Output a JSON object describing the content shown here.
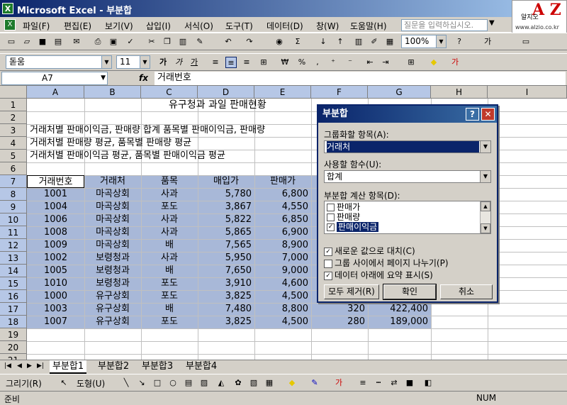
{
  "window": {
    "title": "Microsoft Excel - 부분합"
  },
  "logo": {
    "mark": "A Z",
    "sub": "알지오",
    "url": "www.alzio.co.kr"
  },
  "menu": [
    "파일(F)",
    "편집(E)",
    "보기(V)",
    "삽입(I)",
    "서식(O)",
    "도구(T)",
    "데이터(D)",
    "창(W)",
    "도움말(H)"
  ],
  "help_placeholder": "질문을 입력하십시오.",
  "toolbar": {
    "zoom": "100%",
    "font": "돋움",
    "size": "11"
  },
  "formula_bar": {
    "cell_ref": "A7",
    "fx": "fx",
    "content": "거래번호"
  },
  "columns": [
    "A",
    "B",
    "C",
    "D",
    "E",
    "F",
    "G",
    "H",
    "I"
  ],
  "rows": [
    "1",
    "2",
    "3",
    "4",
    "5",
    "6",
    "7",
    "8",
    "9",
    "10",
    "11",
    "12",
    "13",
    "14",
    "15",
    "16",
    "17",
    "18",
    "19",
    "20",
    "21"
  ],
  "sheet": {
    "title": "유구청과 과일 판매현황",
    "line3": "거래처별 판매이익금, 판매량 합계 품목별 판매이익금, 판매량",
    "line4": "거래처별 판매량 평균, 품목별 판매량 평균",
    "line5": "거래처별 판매이익금 평균, 품목별 판매이익금 평균",
    "headers": [
      "거래번호",
      "거래처",
      "품목",
      "매입가",
      "판매가"
    ],
    "data": [
      [
        "1001",
        "마곡상회",
        "사과",
        "5,780",
        "6,800",
        "",
        ""
      ],
      [
        "1004",
        "마곡상회",
        "포도",
        "3,867",
        "4,550",
        "",
        ""
      ],
      [
        "1006",
        "마곡상회",
        "사과",
        "5,822",
        "6,850",
        "",
        ""
      ],
      [
        "1008",
        "마곡상회",
        "사과",
        "5,865",
        "6,900",
        "",
        ""
      ],
      [
        "1009",
        "마곡상회",
        "배",
        "7,565",
        "8,900",
        "",
        ""
      ],
      [
        "1002",
        "보령청과",
        "사과",
        "5,950",
        "7,000",
        "",
        ""
      ],
      [
        "1005",
        "보령청과",
        "배",
        "7,650",
        "9,000",
        "",
        ""
      ],
      [
        "1010",
        "보령청과",
        "포도",
        "3,910",
        "4,600",
        "",
        ""
      ],
      [
        "1000",
        "유구상회",
        "포도",
        "3,825",
        "4,500",
        "",
        ""
      ],
      [
        "1003",
        "유구상회",
        "배",
        "7,480",
        "8,800",
        "320",
        "422,400"
      ],
      [
        "1007",
        "유구상회",
        "포도",
        "3,825",
        "4,500",
        "280",
        "189,000"
      ]
    ]
  },
  "tabs": [
    "부분합1",
    "부분합2",
    "부분합3",
    "부분합4"
  ],
  "drawbar": {
    "draw": "그리기(R)",
    "shapes": "도형(U)"
  },
  "status": {
    "left": "준비",
    "right": "NUM"
  },
  "dialog": {
    "title": "부분합",
    "group_label": "그룹화할 항목(A):",
    "group_value": "거래처",
    "func_label": "사용할 함수(U):",
    "func_value": "합계",
    "calc_label": "부분합 계산 항목(D):",
    "items": [
      {
        "label": "판매가",
        "checked": false
      },
      {
        "label": "판매량",
        "checked": false
      },
      {
        "label": "판매이익금",
        "checked": true
      }
    ],
    "opt1": "새로운 값으로 대치(C)",
    "opt2": "그룹 사이에서 페이지 나누기(P)",
    "opt3": "데이터 아래에 요약 표시(S)",
    "btn_remove": "모두 제거(R)",
    "btn_ok": "확인",
    "btn_cancel": "취소"
  }
}
